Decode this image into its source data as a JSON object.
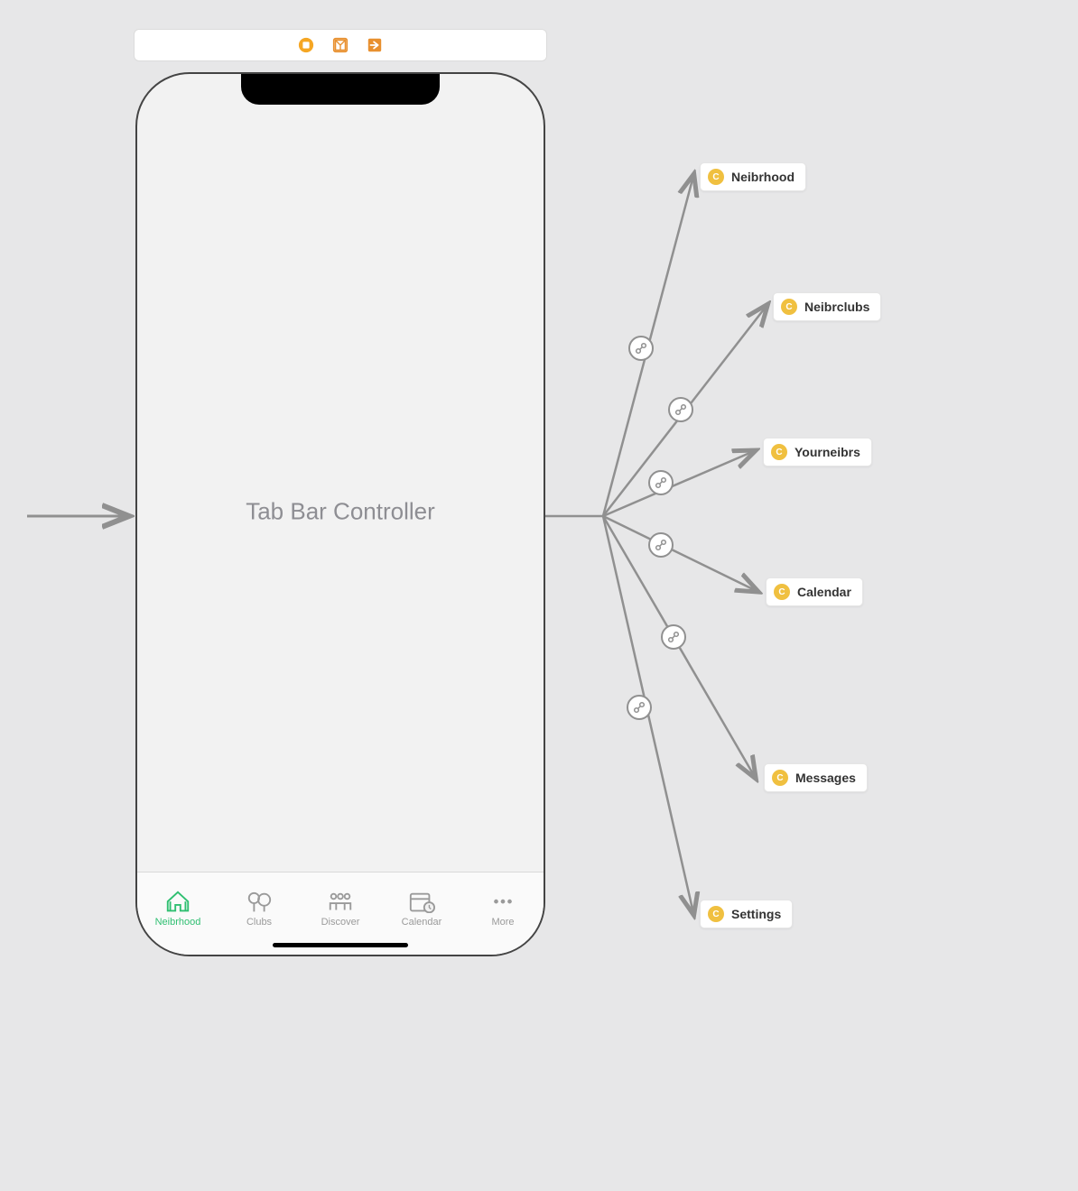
{
  "toolbar": {},
  "phone": {
    "title": "Tab Bar Controller"
  },
  "tabs": [
    {
      "label": "Neibrhood",
      "active": true
    },
    {
      "label": "Clubs"
    },
    {
      "label": "Discover"
    },
    {
      "label": "Calendar"
    },
    {
      "label": "More"
    }
  ],
  "destinations": [
    {
      "label": "Neibrhood"
    },
    {
      "label": "Neibrclubs"
    },
    {
      "label": "Yourneibrs"
    },
    {
      "label": "Calendar"
    },
    {
      "label": "Messages"
    },
    {
      "label": "Settings"
    }
  ]
}
